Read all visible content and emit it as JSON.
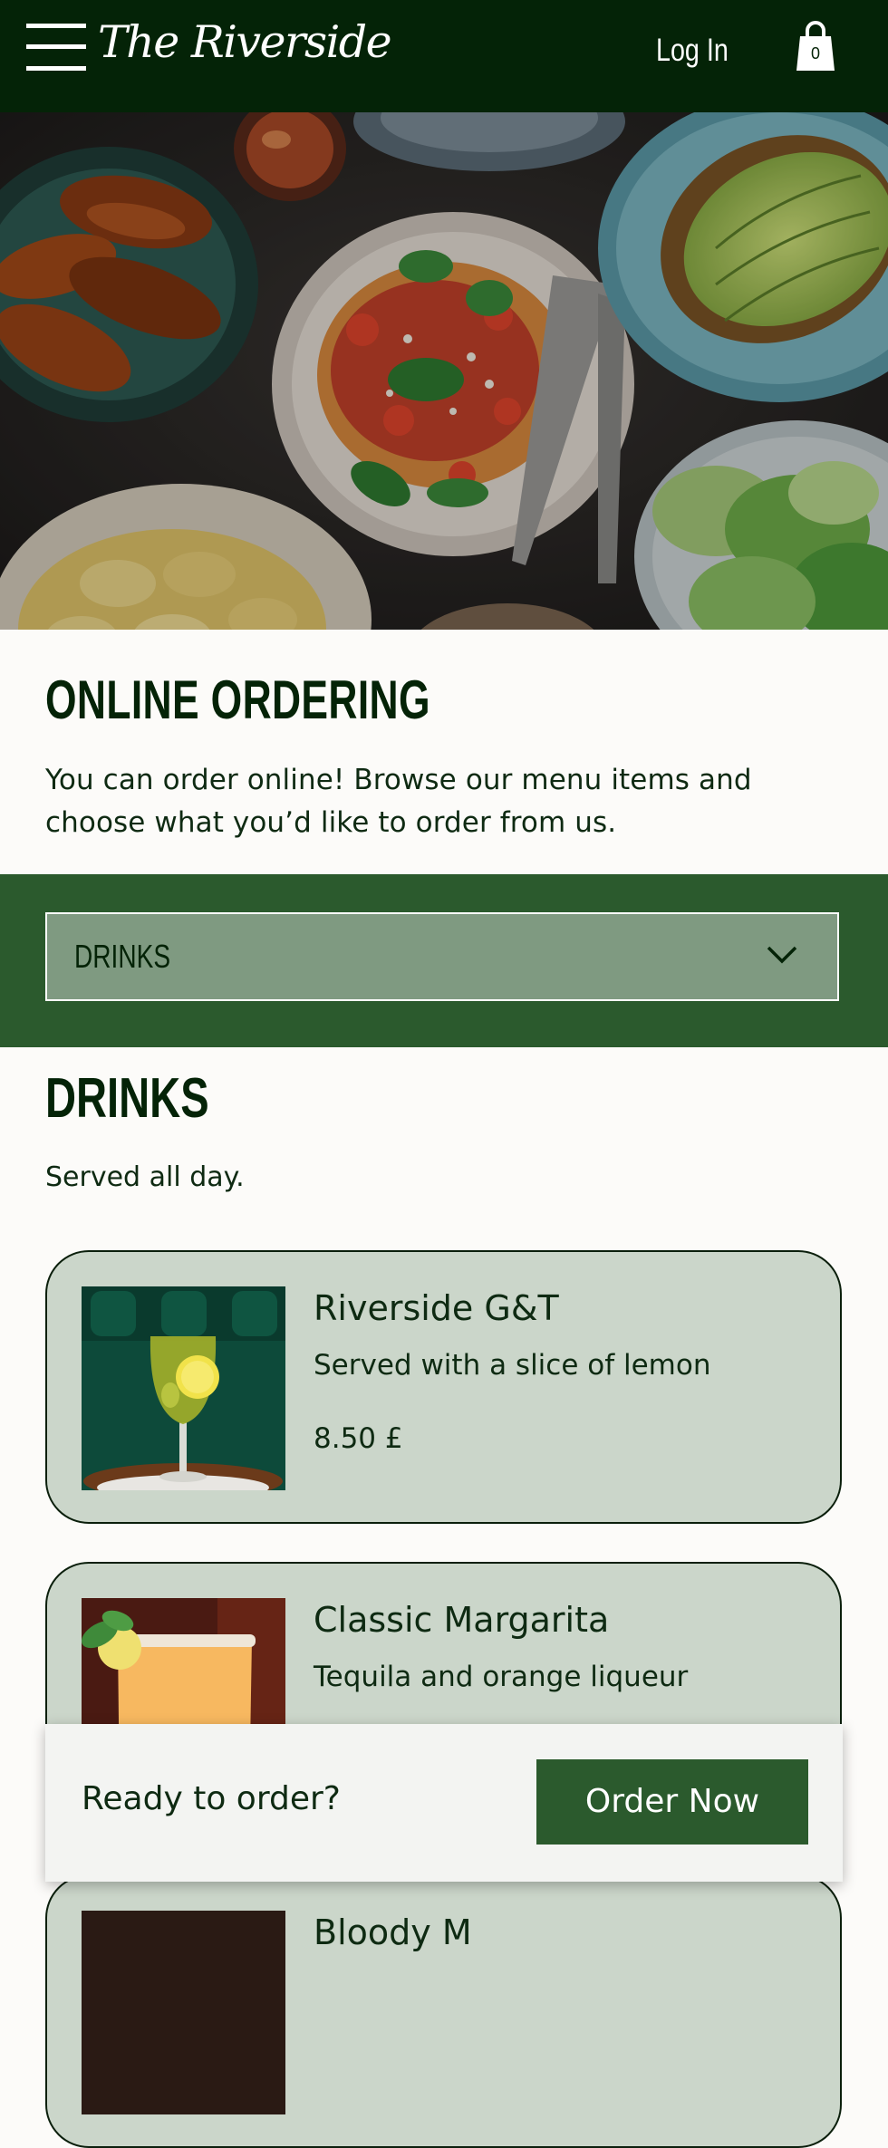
{
  "header": {
    "brand": "The Riverside",
    "login_label": "Log In",
    "cart_count": "0"
  },
  "intro": {
    "title": "ONLINE ORDERING",
    "text": "You can order online! Browse our menu items and choose what you’d like to order from us."
  },
  "category_select": {
    "selected": "DRINKS"
  },
  "section": {
    "title": "DRINKS",
    "subtitle": "Served all day."
  },
  "menu_items": [
    {
      "name": "Riverside G&T",
      "description": "Served with a slice of lemon",
      "price": "8.50 £"
    },
    {
      "name": "Classic Margarita",
      "description": "Tequila and orange liqueur",
      "price": ""
    },
    {
      "name": "Bloody M",
      "description": "",
      "price": ""
    }
  ],
  "order_bar": {
    "prompt": "Ready to order?",
    "button_label": "Order Now"
  },
  "colors": {
    "header_bg": "#042307",
    "band_bg": "#2b5a2d",
    "select_bg": "#7f9a81",
    "card_bg": "#cbd6ca",
    "button_bg": "#2b5a2d",
    "page_bg": "#fcfbf9"
  },
  "icons": {
    "menu": "hamburger-icon",
    "cart": "shopping-bag-icon",
    "dropdown": "chevron-down-icon"
  }
}
